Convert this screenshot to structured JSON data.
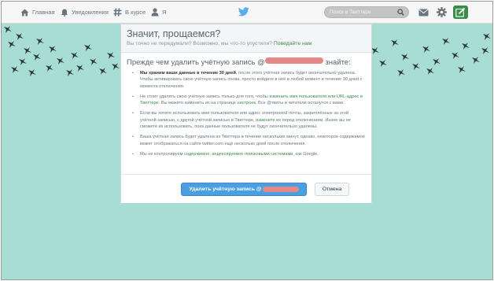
{
  "nav": {
    "home": "Главная",
    "notifications": "Уведомления",
    "discover": "В курсе",
    "me": "Я",
    "search_placeholder": "Поиск в Твиттере"
  },
  "dialog": {
    "title": "Значит, прощаемся?",
    "subtitle_text": "Вы точно не передумали? Возможно, мы что-то упустили?",
    "subtitle_link": "Поведайте нам",
    "before_text": "Прежде чем удалить учётную запись @",
    "redacted_username": "username",
    "before_suffix": " знайте:",
    "bullets": [
      {
        "bold": "Мы храним ваши данные в течение 30 дней",
        "text": ", после этого учётная запись будет окончательно удалена. Чтобы активировать свою учётную запись снова, просто войдите в неё в любой момент в течение 30 дней с момента отключения."
      },
      {
        "pre": "Не стоит удалять свою учётную запись только для того, чтобы ",
        "link1": "изменить имя пользователя или URL-адрес в Твиттере",
        "mid": ". Вы можете изменить их на странице ",
        "link2": "настроек",
        "post": ". Все @твиты и читатели останутся с вами."
      },
      {
        "pre": "Если вы хотите использовать имя пользователя или адрес электронной почты, закреплённые за этой учётной записью, с другой учётной записью в Твиттере, ",
        "link1": "измените их",
        "post": " перед отключением. Иначе вы не сможете их использовать, пока данные пользователя не будут окончательно удалены."
      },
      {
        "text": "Ваша учётная запись будет удалена из Твиттера в течение нескольких минут, однако, некоторое содержимое может отображаться на сайте twitter.com ещё несколько дней после отключения."
      },
      {
        "pre": "Мы не контролируем ",
        "link1": "содержимое, индексируемое поисковыми системами",
        "post": ", как Google."
      }
    ],
    "delete_button": "Удалить учётную запись @",
    "cancel_button": "Отмена"
  },
  "colors": {
    "background": "#a8ddd3",
    "accent_green": "#3b8c4a",
    "primary_button": "#4a9fe0",
    "twitter_blue": "#55acee"
  },
  "icons": [
    "home-icon",
    "bell-icon",
    "hashtag-icon",
    "person-icon",
    "twitter-bird-icon",
    "search-icon",
    "envelope-icon",
    "gear-icon",
    "compose-icon"
  ]
}
